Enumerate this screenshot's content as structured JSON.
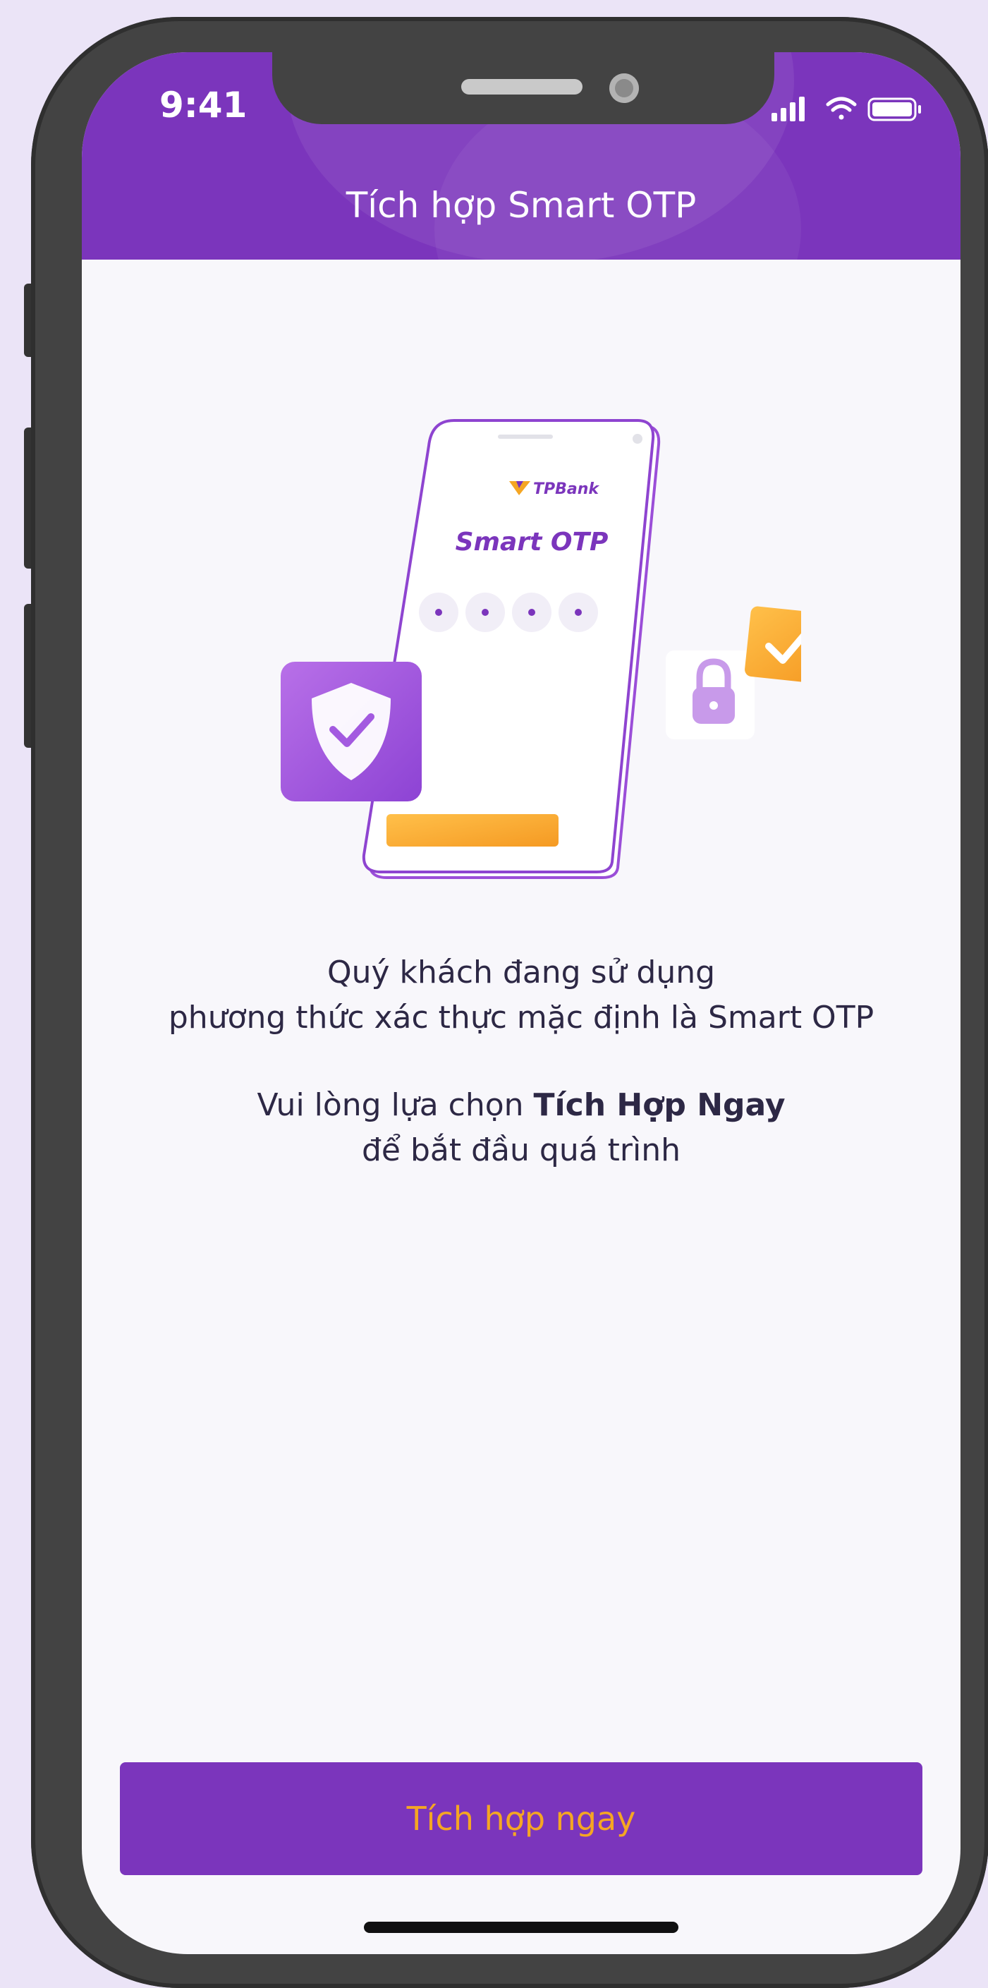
{
  "status_bar": {
    "time": "9:41",
    "icons": [
      "cellular-signal-icon",
      "wifi-icon",
      "battery-icon"
    ]
  },
  "header": {
    "title": "Tích hợp Smart OTP",
    "background": "#7b35bc"
  },
  "illustration": {
    "brand": "TPBank",
    "label": "Smart OTP",
    "pin_dot_count": 4,
    "icons": [
      "shield-check-icon",
      "padlock-icon",
      "checkmark-icon"
    ]
  },
  "message": {
    "line1": "Quý khách đang sử dụng",
    "line2": "phương thức xác thực mặc định là Smart OTP",
    "line3_prefix": "Vui lòng lựa chọn ",
    "line3_bold": "Tích Hợp Ngay",
    "line4": "để bắt đầu quá trình"
  },
  "cta": {
    "label": "Tích hợp ngay",
    "background": "#7b35bc",
    "text_color": "#f5a623"
  },
  "colors": {
    "primary_purple": "#7b35bc",
    "accent_orange": "#f5a623",
    "screen_background": "#f8f7fb",
    "phone_frame": "#434343"
  }
}
